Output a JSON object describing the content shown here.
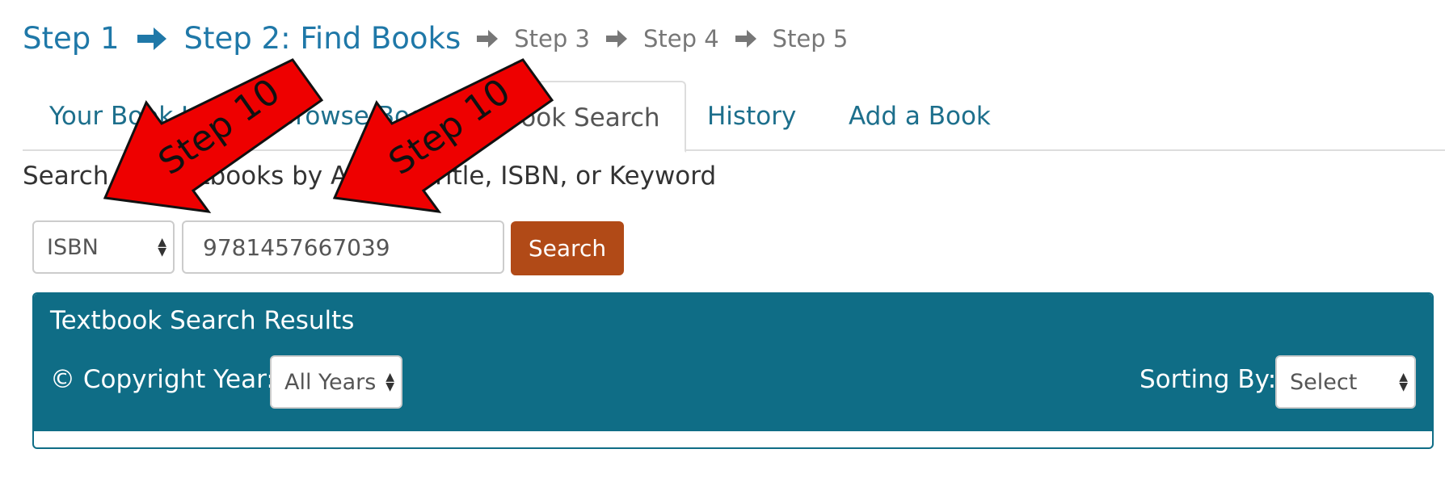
{
  "steps": {
    "step1": "Step 1",
    "step2": "Step 2: Find Books",
    "step3": "Step 3",
    "step4": "Step 4",
    "step5": "Step 5"
  },
  "tabs": [
    {
      "label": "Your Book List"
    },
    {
      "label": "Browse Books"
    },
    {
      "label": "Book Search"
    },
    {
      "label": "History"
    },
    {
      "label": "Add a Book"
    }
  ],
  "search": {
    "label": "Search for Textbooks by Author, Title, ISBN, or Keyword",
    "field_selected": "ISBN",
    "query_value": "9781457667039",
    "button_label": "Search"
  },
  "results": {
    "title": "Textbook Search Results",
    "copyright_label": "© Copyright Year:",
    "copyright_selected": "All Years",
    "sort_label": "Sorting By:",
    "sort_selected": "Select"
  },
  "annotations": [
    {
      "label": "Step 10"
    },
    {
      "label": "Step 10"
    }
  ],
  "colors": {
    "active_step": "#1f78a8",
    "inactive_step": "#777777",
    "tab_link": "#1d6f8c",
    "search_button": "#b14a17",
    "panel": "#0f6d86",
    "annotation_arrow": "#ee0000"
  }
}
